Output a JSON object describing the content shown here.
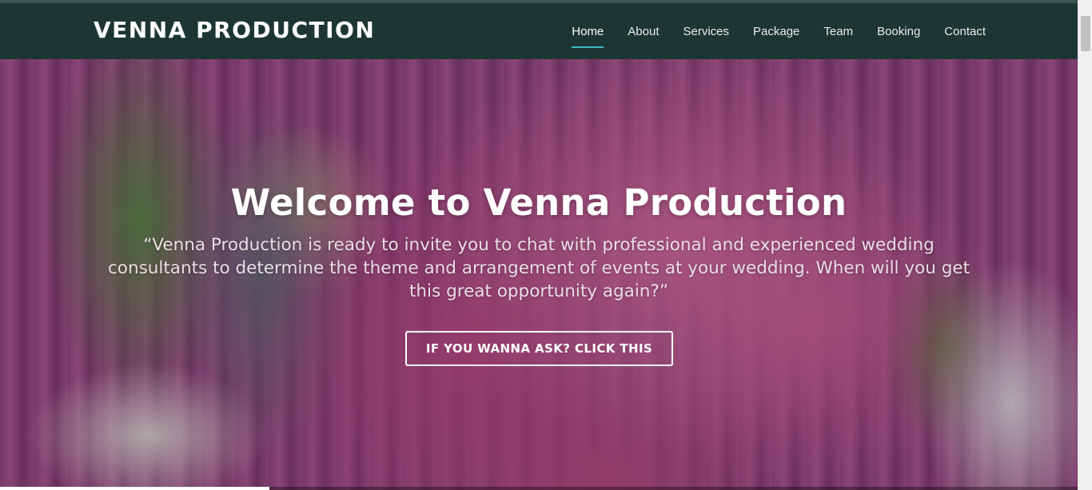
{
  "brand": {
    "name": "VENNA PRODUCTION"
  },
  "nav": {
    "items": [
      {
        "label": "Home",
        "active": true
      },
      {
        "label": "About",
        "active": false
      },
      {
        "label": "Services",
        "active": false
      },
      {
        "label": "Package",
        "active": false
      },
      {
        "label": "Team",
        "active": false
      },
      {
        "label": "Booking",
        "active": false
      },
      {
        "label": "Contact",
        "active": false
      }
    ],
    "active_color": "#3fbbc0"
  },
  "hero": {
    "title": "Welcome to Venna Production",
    "subtitle": "“Venna Production is ready to invite you to chat with professional and experienced wedding consultants to determine the theme and arrangement of events at your wedding. When will you get this great opportunity again?”",
    "button_label": "IF YOU WANNA ASK? CLICK THIS",
    "slide_progress": 0.25
  },
  "colors": {
    "navbar": "#1d3633",
    "hero_pink": "#c24d89",
    "text": "#ffffff"
  }
}
